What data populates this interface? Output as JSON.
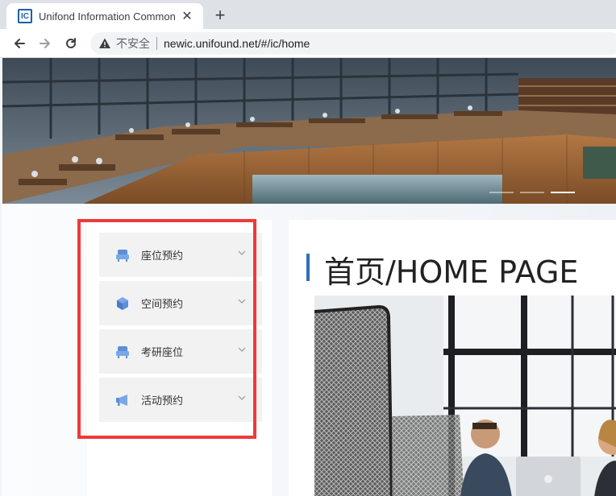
{
  "browser": {
    "tab_title": "Unifond Information Common",
    "favicon_text": "IC",
    "tab_close": "✕",
    "new_tab": "+",
    "security_label": "不安全",
    "url": "newic.unifound.net/#/ic/home"
  },
  "banner": {
    "slides": 3,
    "active_slide": 3
  },
  "sidebar": {
    "items": [
      {
        "label": "座位预约",
        "icon": "seat-icon"
      },
      {
        "label": "空间预约",
        "icon": "cube-icon"
      },
      {
        "label": "考研座位",
        "icon": "seat-icon"
      },
      {
        "label": "活动预约",
        "icon": "megaphone-icon"
      }
    ]
  },
  "main": {
    "title": "首页/HOME PAGE"
  },
  "colors": {
    "accent": "#2f6fba",
    "icon_blue": "#5b8fd6",
    "highlight": "#ee3a3a"
  }
}
